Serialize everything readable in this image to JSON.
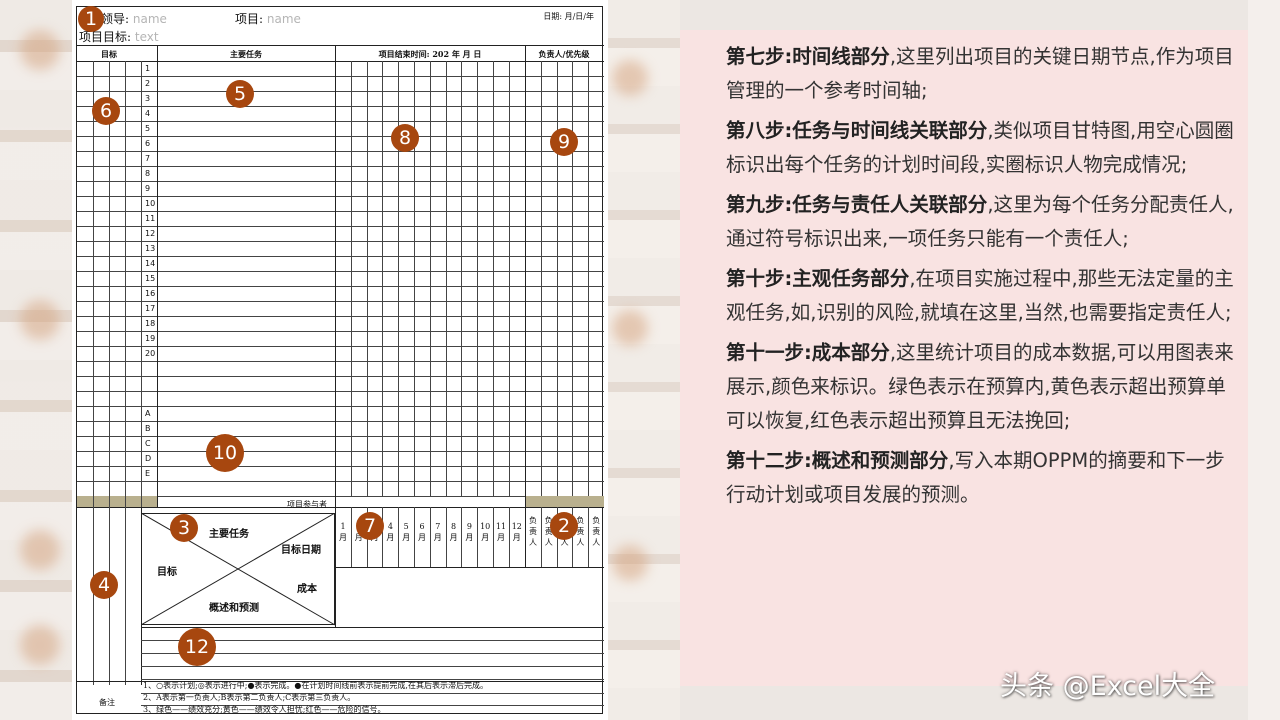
{
  "form": {
    "leader_label": "领导:",
    "leader_value": "name",
    "project_label": "项目:",
    "project_value": "name",
    "date_label": "日期: 月/日/年",
    "goal_label": "项目目标:",
    "goal_value": "text",
    "col_goal": "目标",
    "col_tasks": "主要任务",
    "col_deadline": "项目结束时间: 202 年 月 日",
    "col_owner": "负责人/优先级",
    "task_numbers": [
      "1",
      "2",
      "3",
      "4",
      "5",
      "6",
      "7",
      "8",
      "9",
      "10",
      "11",
      "12",
      "13",
      "14",
      "15",
      "16",
      "17",
      "18",
      "19",
      "20"
    ],
    "subjective_letters": [
      "A",
      "B",
      "C",
      "D",
      "E"
    ],
    "participants": "项目参与者",
    "diag_tasks": "主要任务",
    "diag_target_date": "目标日期",
    "diag_goal": "目标",
    "diag_cost": "成本",
    "diag_summary": "概述和预测",
    "months": [
      "1",
      "2",
      "3",
      "4",
      "5",
      "6",
      "7",
      "8",
      "9",
      "10",
      "11",
      "12"
    ],
    "month_unit": "月",
    "owner_header": "负责人",
    "notes_title": "备注",
    "notes": [
      "1、○表示计划;◎表示进行中;●表示完成。●在计划时间线前表示提前完成,在其后表示滞后完成。",
      "2、A表示第一负责人;B表示第二负责人;C表示第三负责人。",
      "3、绿色——绩效充分;黄色——绩效令人担忧;红色——危险的信号。"
    ]
  },
  "badges": [
    "1",
    "2",
    "3",
    "4",
    "5",
    "6",
    "7",
    "8",
    "9",
    "10",
    "12"
  ],
  "steps": [
    {
      "title": "第七步:时间线部分",
      "body": ",这里列出项目的关键日期节点,作为项目管理的一个参考时间轴;"
    },
    {
      "title": "第八步:任务与时间线关联部分",
      "body": ",类似项目甘特图,用空心圆圈标识出每个任务的计划时间段,实圈标识人物完成情况;"
    },
    {
      "title": "第九步:任务与责任人关联部分",
      "body": ",这里为每个任务分配责任人,通过符号标识出来,一项任务只能有一个责任人;"
    },
    {
      "title": "第十步:主观任务部分",
      "body": ",在项目实施过程中,那些无法定量的主观任务,如,识别的风险,就填在这里,当然,也需要指定责任人;"
    },
    {
      "title": "第十一步:成本部分",
      "body": ",这里统计项目的成本数据,可以用图表来展示,颜色来标识。绿色表示在预算内,黄色表示超出预算单可以恢复,红色表示超出预算且无法挽回;"
    },
    {
      "title": "第十二步:概述和预测部分",
      "body": ",写入本期OPPM的摘要和下一步行动计划或项目发展的预测。"
    }
  ],
  "watermark": "头条 @Excel大全",
  "colors": {
    "badge": "#a7470f",
    "panel": "#f9e3e2",
    "band": "#b9b08e"
  }
}
